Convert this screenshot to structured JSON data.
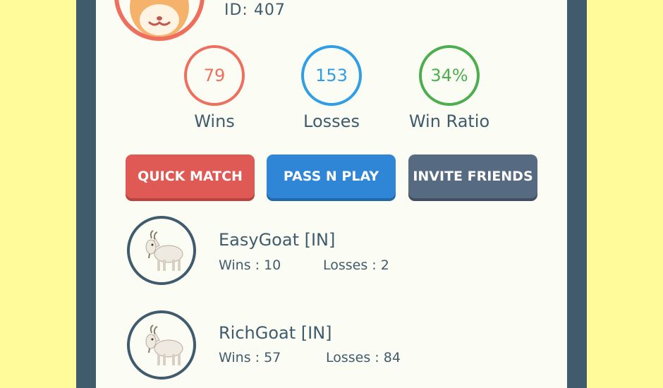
{
  "profile": {
    "id_label": "ID:",
    "id_value": "407",
    "avatar_icon": "cat-face-icon"
  },
  "stats": [
    {
      "value": "79",
      "label": "Wins",
      "color": "#ef6f5f"
    },
    {
      "value": "153",
      "label": "Losses",
      "color": "#2f9ee6"
    },
    {
      "value": "34%",
      "label": "Win Ratio",
      "color": "#4cae4f"
    }
  ],
  "buttons": {
    "quick_match": {
      "label": "QUICK MATCH",
      "color": "#e05a55"
    },
    "pass_n_play": {
      "label": "PASS N PLAY",
      "color": "#2f86d6"
    },
    "invite_friends": {
      "label": "INVITE FRIENDS",
      "color": "#566a82"
    }
  },
  "opponents": [
    {
      "name": "EasyGoat [IN]",
      "wins_label": "Wins :",
      "wins": "10",
      "losses_label": "Losses :",
      "losses": "2",
      "icon": "goat-icon"
    },
    {
      "name": "RichGoat [IN]",
      "wins_label": "Wins :",
      "wins": "57",
      "losses_label": "Losses :",
      "losses": "84",
      "icon": "goat-icon"
    }
  ],
  "colors": {
    "background": "#fffb9b",
    "frame": "#3f5b6c",
    "screen": "#fbfdf4",
    "text": "#3f5b6c"
  }
}
